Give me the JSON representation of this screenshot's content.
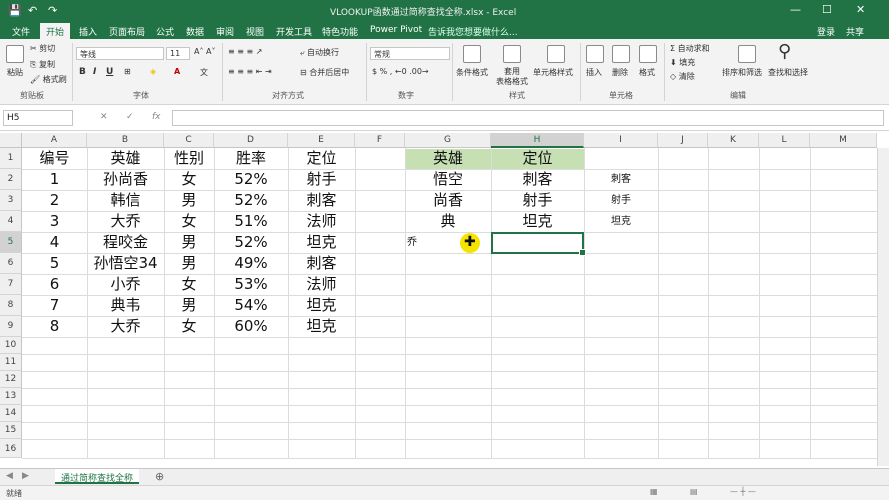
{
  "window": {
    "title": "VLOOKUP函数通过简称查找全称.xlsx - Excel",
    "login": "登录",
    "share": "共享"
  },
  "tabs": [
    "文件",
    "开始",
    "插入",
    "页面布局",
    "公式",
    "数据",
    "审阅",
    "视图",
    "开发工具",
    "特色功能",
    "Power Pivot"
  ],
  "active_tab": "开始",
  "tell_me": "告诉我您想要做什么...",
  "ribbon": {
    "clipboard": {
      "paste": "粘贴",
      "cut": "剪切",
      "copy": "复制",
      "format_painter": "格式刷",
      "label": "剪贴板"
    },
    "font": {
      "name": "等线",
      "size": "11",
      "bold": "B",
      "italic": "I",
      "underline": "U",
      "label": "字体"
    },
    "alignment": {
      "wrap": "自动换行",
      "merge": "合并后居中",
      "label": "对齐方式"
    },
    "number": {
      "format": "常规",
      "label": "数字"
    },
    "styles": {
      "conditional": "条件格式",
      "table": "套用\n表格格式",
      "cell_styles": "单元格样式",
      "label": "样式"
    },
    "cells": {
      "insert": "插入",
      "delete": "删除",
      "format": "格式",
      "label": "单元格"
    },
    "editing": {
      "autosum": "自动求和",
      "fill": "填充",
      "clear": "清除",
      "sort": "排序和筛选",
      "find": "查找和选择",
      "label": "编辑"
    }
  },
  "namebox": "H5",
  "fx": "fx",
  "columns": [
    "A",
    "B",
    "C",
    "D",
    "E",
    "F",
    "G",
    "H",
    "I",
    "J",
    "K",
    "L",
    "M"
  ],
  "selected_column": "H",
  "rows": [
    "1",
    "2",
    "3",
    "4",
    "5",
    "6",
    "7",
    "8",
    "9",
    "10",
    "11",
    "12",
    "13",
    "14",
    "15"
  ],
  "selected_row": "5",
  "table_main": {
    "headers": [
      "编号",
      "英雄",
      "性别",
      "胜率",
      "定位"
    ],
    "rows": [
      [
        "1",
        "孙尚香",
        "女",
        "52%",
        "射手"
      ],
      [
        "2",
        "韩信",
        "男",
        "52%",
        "刺客"
      ],
      [
        "3",
        "大乔",
        "女",
        "51%",
        "法师"
      ],
      [
        "4",
        "程咬金",
        "男",
        "52%",
        "坦克"
      ],
      [
        "5",
        "孙悟空34",
        "男",
        "49%",
        "刺客"
      ],
      [
        "6",
        "小乔",
        "女",
        "53%",
        "法师"
      ],
      [
        "7",
        "典韦",
        "男",
        "54%",
        "坦克"
      ],
      [
        "8",
        "大乔",
        "女",
        "60%",
        "坦克"
      ]
    ]
  },
  "table_lookup": {
    "headers": [
      "英雄",
      "定位"
    ],
    "rows": [
      [
        "悟空",
        "刺客"
      ],
      [
        "尚香",
        "射手"
      ],
      [
        "典",
        "坦克"
      ]
    ],
    "g5": "乔"
  },
  "col_i": [
    "刺客",
    "射手",
    "坦克"
  ],
  "sheet_tab": "通过简称查找全称",
  "status": "就绪",
  "colors": {
    "excel_green": "#217346",
    "header_fill": "#c6e0b4"
  }
}
